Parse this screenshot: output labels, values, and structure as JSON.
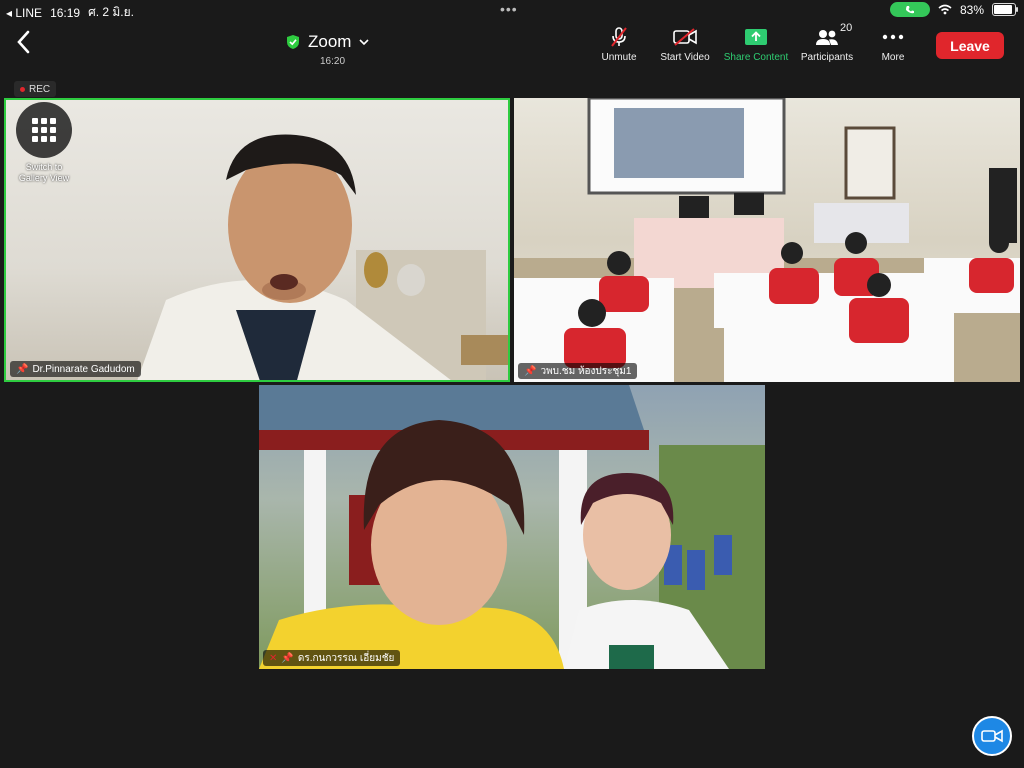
{
  "status_bar": {
    "back_app": "LINE",
    "time": "16:19",
    "date": "ศ. 2 มิ.ย.",
    "dots": "•••",
    "battery": "83%"
  },
  "topbar": {
    "title": "Zoom",
    "meeting_time": "16:20",
    "buttons": {
      "unmute": "Unmute",
      "start_video": "Start Video",
      "share_content": "Share Content",
      "participants": "Participants",
      "participants_count": "20",
      "more": "More",
      "leave": "Leave"
    }
  },
  "recording": {
    "label": "REC"
  },
  "gallery_toggle": {
    "line1": "Switch to",
    "line2": "Gallery View"
  },
  "tiles": [
    {
      "name": "Dr.Pinnarate Gadudom"
    },
    {
      "name": "วพบ.ชม ห้องประชุม1"
    },
    {
      "name": "ดร.กนกวรรณ เอี่ยมชัย"
    }
  ],
  "colors": {
    "accent_green": "#2ecc40",
    "leave_red": "#e0262c",
    "share_green": "#2ecc71",
    "fab_blue": "#1e88e5"
  }
}
